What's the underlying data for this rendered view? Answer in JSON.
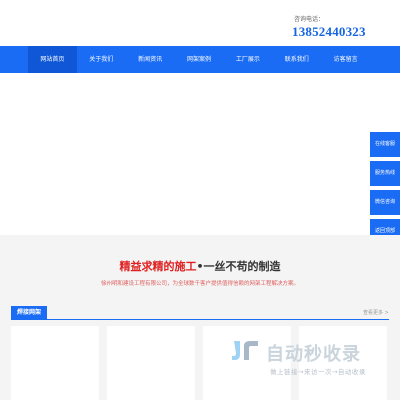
{
  "header": {
    "hotline_label": "咨询电话：",
    "hotline_number": "13852440323"
  },
  "nav": {
    "items": [
      "网站首页",
      "关于我们",
      "新闻资讯",
      "网架案例",
      "工厂展示",
      "联系我们",
      "访客留言"
    ]
  },
  "sidebar": {
    "items": [
      "在线客服",
      "服务热线",
      "微信咨询",
      "返回顶部"
    ]
  },
  "section": {
    "slogan_highlight": "精益求精的施工",
    "slogan_rest": "•一丝不苟的制造",
    "subtitle": "徐州明和建设工程有限公司，为全球数千客户提供值得信赖的网架工程解决方案。",
    "category_tab": "焊接网架",
    "more_link": "查看更多 >"
  },
  "watermark": {
    "title": "自动秒收录",
    "subtitle": "做上链接→来访一次→自动收录"
  },
  "colors": {
    "accent": "#1a6cf5",
    "highlight": "#e02020"
  }
}
